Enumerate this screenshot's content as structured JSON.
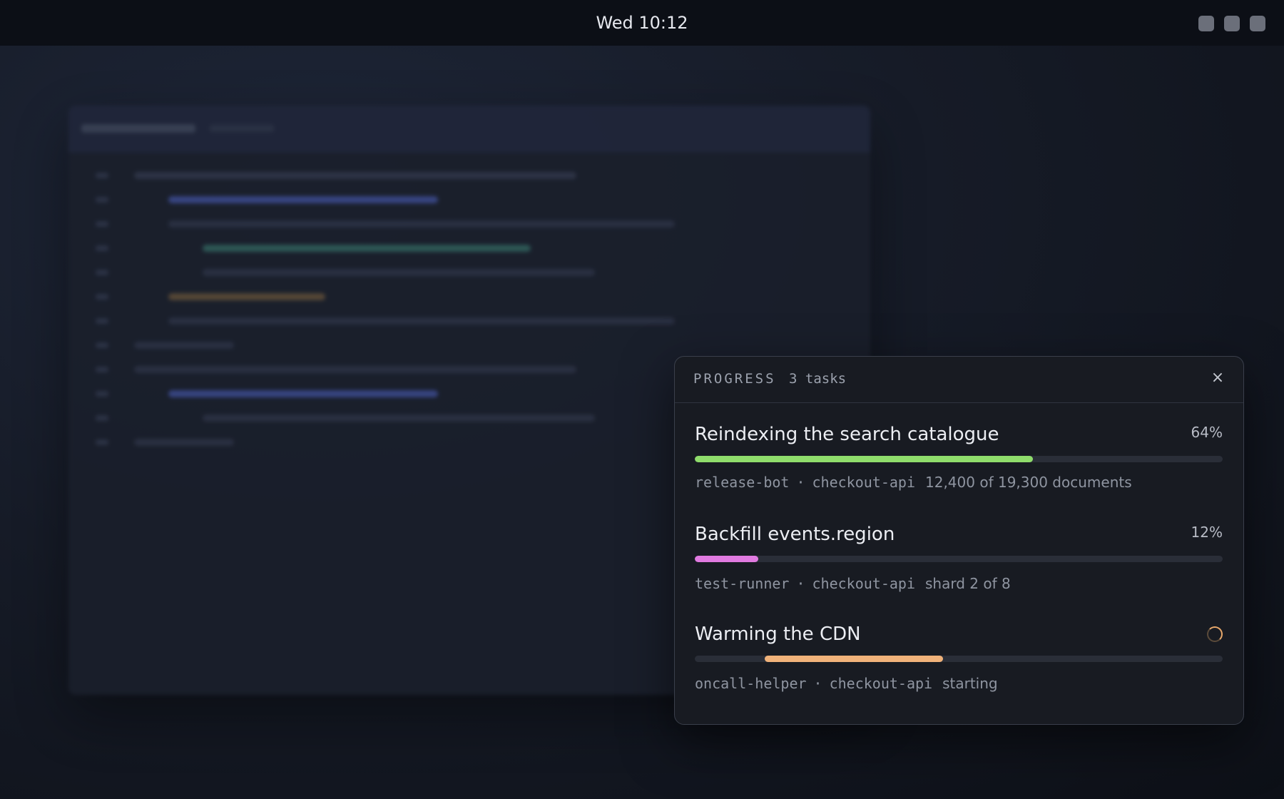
{
  "topbar": {
    "clock": "Wed 10:12",
    "tray_icons": [
      "tray-icon-1",
      "tray-icon-2",
      "tray-icon-3"
    ]
  },
  "panel": {
    "title": "PROGRESS",
    "count_label": "3 tasks",
    "close_label": "×",
    "tasks": [
      {
        "title": "Reindexing the search catalogue",
        "percent_label": "64%",
        "progress": 0.64,
        "bar_color": "#8fdc6b",
        "owner": "release-bot",
        "service": "checkout-api",
        "detail": "12,400 of 19,300 documents"
      },
      {
        "title": "Backfill events.region",
        "percent_label": "12%",
        "progress": 0.12,
        "bar_color": "#e07ae0",
        "owner": "test-runner",
        "service": "checkout-api",
        "detail": "shard 2 of 8"
      },
      {
        "title": "Warming the CDN",
        "percent_label": "",
        "progress": null,
        "indeterminate": true,
        "bar_color": "#f0b27a",
        "owner": "oncall-helper",
        "service": "checkout-api",
        "detail": "starting",
        "status_icon": "loading-spinner-icon"
      }
    ]
  },
  "separator": "·"
}
